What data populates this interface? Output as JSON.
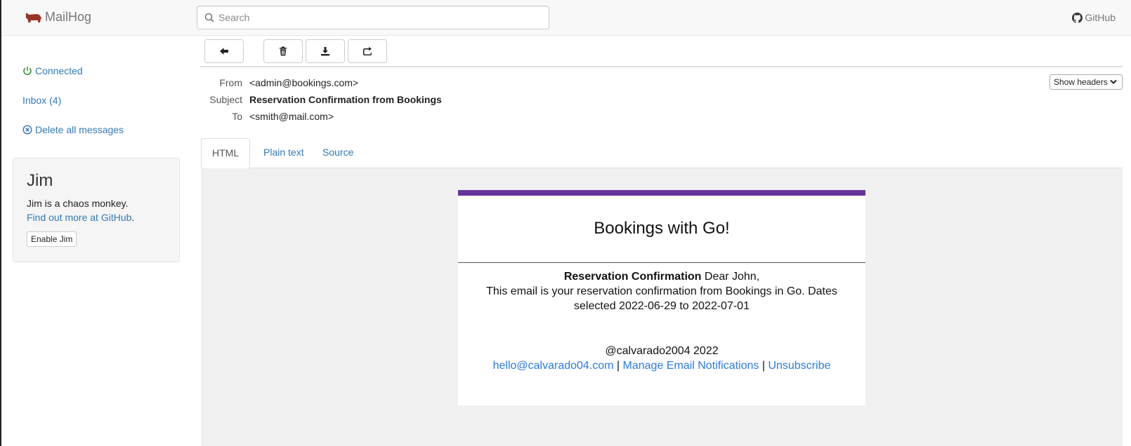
{
  "navbar": {
    "brand": "MailHog",
    "search_placeholder": "Search",
    "github_label": "GitHub"
  },
  "sidebar": {
    "connected": "Connected",
    "inbox": "Inbox (4)",
    "delete_all": "Delete all messages",
    "jim": {
      "title": "Jim",
      "description": "Jim is a chaos monkey.",
      "link": "Find out more at GitHub",
      "link_suffix": ".",
      "button": "Enable Jim"
    }
  },
  "toolbar": {
    "icons": [
      "arrow-left-icon",
      "trash-icon",
      "download-icon",
      "share-icon"
    ]
  },
  "message": {
    "from_label": "From",
    "from": "<admin@bookings.com>",
    "subject_label": "Subject",
    "subject": "Reservation Confirmation from Bookings",
    "to_label": "To",
    "to": "<smith@mail.com>",
    "show_headers": "Show headers"
  },
  "tabs": [
    "HTML",
    "Plain text",
    "Source"
  ],
  "email": {
    "heading": "Bookings with Go!",
    "intro_bold": "Reservation Confirmation",
    "intro_rest": " Dear John,",
    "line1": "This email is your reservation confirmation from Bookings in Go. Dates",
    "line2": "selected 2022-06-29 to 2022-07-01",
    "copyright": "@calvarado2004 2022",
    "footer_email": "hello@calvarado04.com",
    "separator": " | ",
    "footer_manage": "Manage Email Notifications",
    "footer_unsubscribe": "Unsubscribe",
    "accent_color": "#663399"
  },
  "colors": {
    "link": "#337ab7",
    "connected": "#3c9a3c",
    "brand_icon": "#9b3327"
  }
}
